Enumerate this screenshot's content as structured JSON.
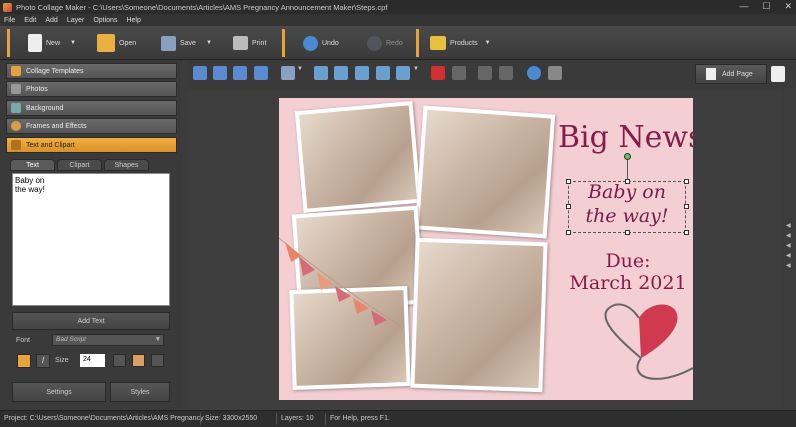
{
  "window": {
    "title": "Photo Collage Maker - C:\\Users\\Someone\\Documents\\Articles\\AMS Pregnancy Announcement Maker\\Steps.cpf",
    "controls": [
      "—",
      "☐",
      "✕"
    ]
  },
  "menu": [
    "File",
    "Edit",
    "Add",
    "Layer",
    "Options",
    "Help"
  ],
  "toolbar": {
    "new": "New",
    "open": "Open",
    "save": "Save",
    "print": "Print",
    "undo": "Undo",
    "redo": "Redo",
    "products": "Products"
  },
  "categories": [
    "Collage Templates",
    "Photos",
    "Background",
    "Frames and Effects",
    "Text and Clipart"
  ],
  "tabs": [
    "Text",
    "Clipart",
    "Shapes"
  ],
  "text_content": "Baby on\nthe way!",
  "add_text": "Add Text",
  "font": {
    "label": "Font",
    "value": "Bad Script",
    "size_label": "Size",
    "size_value": "24"
  },
  "settings": "Settings",
  "styles": "Styles",
  "add_page": "Add Page",
  "canvas": {
    "headline": "Big News!",
    "line1": "Baby on",
    "line2": "the way!",
    "due1": "Due:",
    "due2": "March 2021"
  },
  "status": {
    "project": "Project: C:\\Users\\Someone\\Documents\\Articles\\AMS Pregnancy ...",
    "size": "Size: 3300x2550",
    "layers": "Layers: 10",
    "help": "For Help, press F1."
  },
  "colors": {
    "accent": "#e8a23c",
    "page_bg": "#f3cfd4",
    "headline": "#8a1a4a"
  }
}
